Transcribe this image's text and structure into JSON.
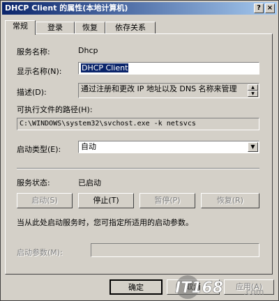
{
  "window": {
    "title": "DHCP Client 的属性(本地计算机)",
    "help_btn": "?",
    "close_btn": "×"
  },
  "tabs": [
    {
      "label": "常规",
      "active": true
    },
    {
      "label": "登录",
      "active": false
    },
    {
      "label": "恢复",
      "active": false
    },
    {
      "label": "依存关系",
      "active": false
    }
  ],
  "general": {
    "service_name_label": "服务名称:",
    "service_name_value": "Dhcp",
    "display_name_label": "显示名称(N):",
    "display_name_value": "DHCP Client",
    "description_label": "描述(D):",
    "description_value": "通过注册和更改 IP 地址以及 DNS 名称来管理",
    "exe_path_label": "可执行文件的路径(H):",
    "exe_path_value": "C:\\WINDOWS\\system32\\svchost.exe -k netsvcs",
    "startup_type_label": "启动类型(E):",
    "startup_type_value": "自动",
    "status_label": "服务状态:",
    "status_value": "已启动",
    "hint_text": "当从此处启动服务时，您可指定所适用的启动参数。",
    "params_label": "启动参数(M):",
    "params_value": ""
  },
  "service_buttons": {
    "start": "启动(S)",
    "stop": "停止(T)",
    "pause": "暂停(P)",
    "resume": "恢复(R)"
  },
  "dialog_buttons": {
    "ok": "确定",
    "cancel": "取消",
    "apply": "应用(A)"
  },
  "watermark": {
    "text": "IT168",
    "suffix": ".com"
  },
  "icons": {
    "dropdown": "chevron-down-icon",
    "spin_up": "arrow-up-icon",
    "spin_down": "arrow-down-icon"
  }
}
